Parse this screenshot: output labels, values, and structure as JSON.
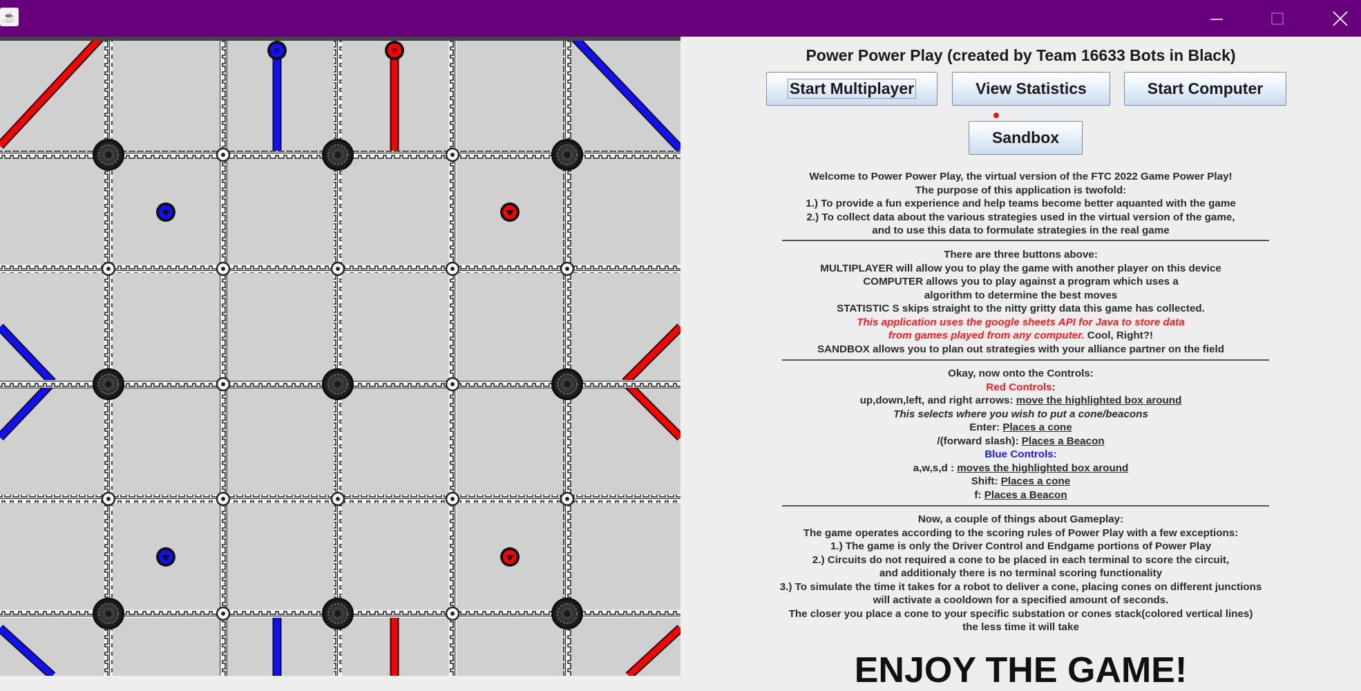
{
  "window": {
    "app_icon": "java-coffee-icon",
    "minimize_icon": "minimize-icon",
    "maximize_icon": "maximize-icon",
    "close_icon": "close-icon",
    "titlebar_color": "#68007e"
  },
  "board": {
    "background": "#d0d0d0",
    "red_color": "#ff0000",
    "blue_color": "#1010ff",
    "pieces": [
      "blue-cone-icon",
      "red-cone-icon",
      "blue-beacon-icon",
      "red-beacon-icon",
      "junction-icon"
    ]
  },
  "main": {
    "title": "Power Power Play (created by Team 16633 Bots in Black)",
    "buttons": {
      "multiplayer": "Start Multiplayer",
      "statistics": "View Statistics",
      "computer": "Start Computer",
      "sandbox": "Sandbox"
    },
    "intro": {
      "l1": "Welcome to Power Power Play, the virtual version of the FTC 2022 Game Power Play!",
      "l2": "The purpose of this application is twofold:",
      "l3": "1.) To provide a fun experience and help teams become better aquanted with the game",
      "l4": "2.) To collect data about the various strategies used in the virtual version of the game,",
      "l5": "and to use this data to formulate strategies in the real game"
    },
    "buttons_help": {
      "l1": "There are three buttons above:",
      "l2": "MULTIPLAYER  will allow you to play the game with another player on this device",
      "l3": "COMPUTER allows you to play against a program which uses a",
      "l4": "algorithm to determine the best moves",
      "l5": "STATISTIC S skips straight to the nitty gritty data this game has collected.",
      "l6": "This application uses the google sheets API for Java to store data",
      "l7a": "from games played from any computer.",
      "l7b": " Cool, Right?!",
      "l8": "SANDBOX allows you to plan out strategies with your alliance partner on the field"
    },
    "controls": {
      "header": "Okay, now onto the Controls:",
      "red_header": "Red Controls",
      "colon": ":",
      "arrows_key": "up,down,left, and right arrows: ",
      "arrows_action": "move the highlighted box around",
      "note": "This selects where you wish to put a cone/beacons",
      "enter_key": "Enter: ",
      "enter_action": "Places a cone",
      "slash_key": "/(forward slash): ",
      "slash_action": "Places a Beacon",
      "blue_header": "Blue Controls:",
      "wasd_key": "a,w,s,d : ",
      "wasd_action": "moves the highlighted box around",
      "shift_key": "Shift: ",
      "shift_action": "Places a cone",
      "f_key": "f: ",
      "f_action": "Places a Beacon"
    },
    "gameplay": {
      "l1": "Now, a couple of things about Gameplay:",
      "l2": "The game operates according to the scoring rules of Power Play with a few exceptions:",
      "l3": "1.) The game is only the Driver Control and Endgame portions of Power Play",
      "l4": "2.) Circuits do not required a cone to be placed in each terminal to score the circuit,",
      "l5": "and additionaly there is no terminal scoring functionality",
      "l6": "3.) To simulate the time it takes for a robot to deliver a cone, placing cones on different junctions",
      "l7": "will activate a cooldown for a specified amount of seconds.",
      "l8": "The closer you place a cone to your specific substation or cones stack(colored vertical lines)",
      "l9": "the less time it will take"
    },
    "enjoy": "ENJOY THE GAME!"
  }
}
